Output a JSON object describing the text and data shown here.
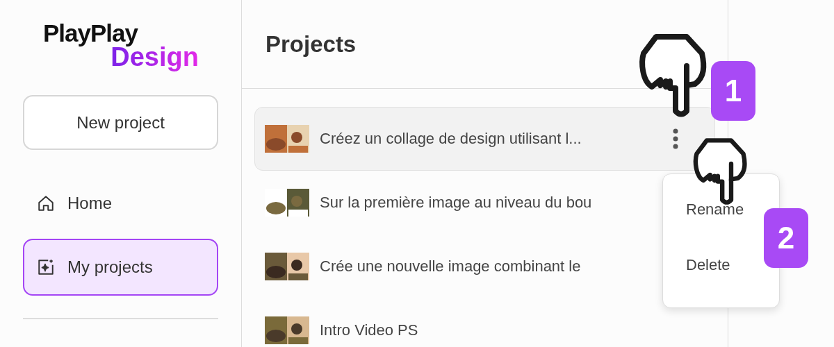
{
  "sidebar": {
    "logo": {
      "line_1": "PlayPlay",
      "line_2": "Design"
    },
    "new_project_button": "New project",
    "nav": [
      {
        "label": "Home",
        "selected": false
      },
      {
        "label": "My projects",
        "selected": true
      }
    ]
  },
  "main": {
    "title": "Projects",
    "projects": [
      {
        "title": "Créez un collage de design utilisant l...",
        "highlighted": true
      },
      {
        "title": "Sur la première image au niveau du bou",
        "highlighted": false
      },
      {
        "title": "Crée une nouvelle image combinant le",
        "highlighted": false
      },
      {
        "title": "Intro Video PS",
        "highlighted": false
      }
    ],
    "context_menu": {
      "items": [
        "Rename",
        "Delete"
      ]
    }
  },
  "tutorial_steps": [
    {
      "number": "1"
    },
    {
      "number": "2"
    }
  ]
}
